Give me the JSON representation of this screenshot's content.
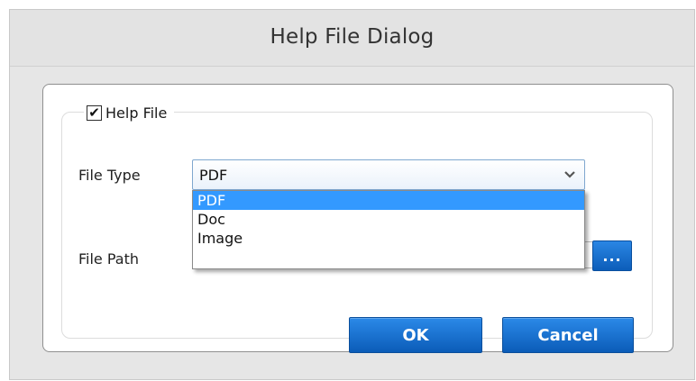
{
  "dialog": {
    "title": "Help File Dialog"
  },
  "help_file": {
    "checkbox_label": "Help File",
    "checked": true,
    "check_glyph": "✔"
  },
  "file_type": {
    "label": "File Type",
    "selected_value": "PDF",
    "options": [
      "PDF",
      "Doc",
      "Image"
    ],
    "highlighted_index": 0
  },
  "file_path": {
    "label": "File Path",
    "value": "",
    "browse_label": "..."
  },
  "buttons": {
    "ok_label": "OK",
    "cancel_label": "Cancel"
  },
  "icons": {
    "dropdown_chevron": "chevron-down-icon",
    "checkbox_check": "check-icon"
  },
  "colors": {
    "accent": "#1a73d6",
    "selection": "#3399ff",
    "title_bar": "#e3e3e3"
  }
}
